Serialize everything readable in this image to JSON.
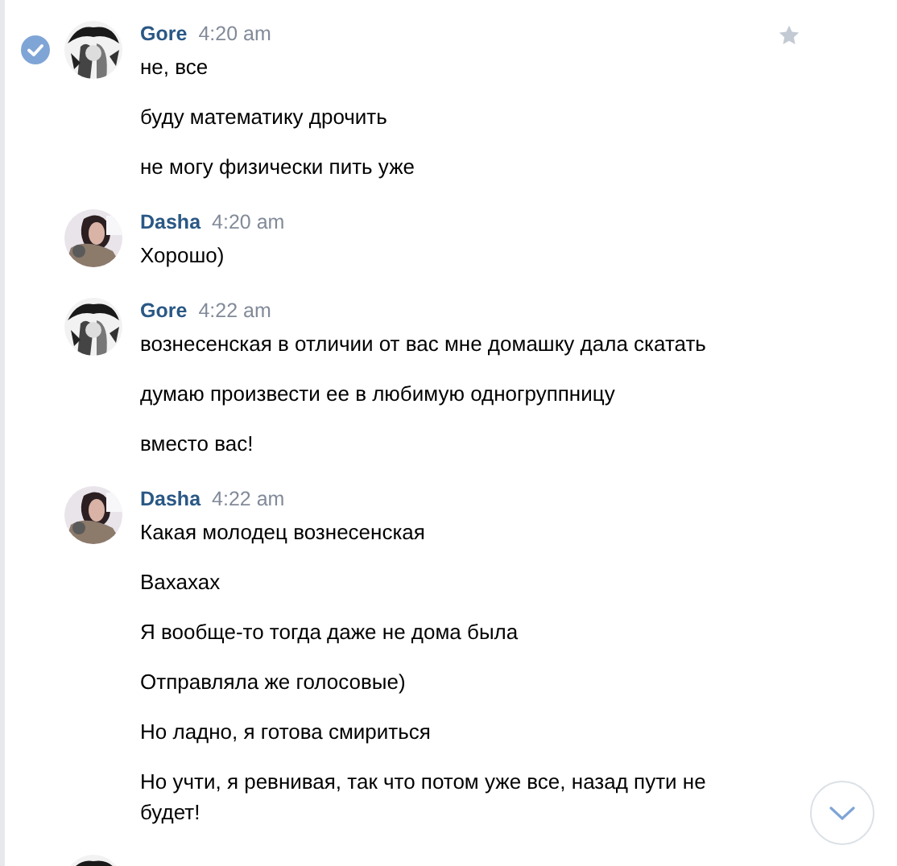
{
  "messages": [
    {
      "author": "Gore",
      "avatar": {
        "kind": "picture"
      },
      "time": "4:20 am",
      "selected": true,
      "texts": [
        "не, все",
        "буду математику дрочить",
        "не могу физически пить уже"
      ]
    },
    {
      "author": "Dasha",
      "avatar": {
        "kind": "picture"
      },
      "time": "4:20 am",
      "selected": false,
      "texts": [
        "Хорошо)"
      ]
    },
    {
      "author": "Gore",
      "avatar": {
        "kind": "picture"
      },
      "time": "4:22 am",
      "selected": false,
      "texts": [
        "вознесенская в отличии от вас мне домашку дала скатать",
        "думаю произвести ее в любимую одногруппницу",
        "вместо вас!"
      ]
    },
    {
      "author": "Dasha",
      "avatar": {
        "kind": "picture"
      },
      "time": "4:22 am",
      "selected": false,
      "texts": [
        "Какая молодец вознесенская",
        "Вахахах",
        "Я вообще-то тогда даже не дома была",
        "Отправляла же голосовые)",
        "Но ладно, я готова смириться",
        "Но учти, я ревнивая, так что потом уже все, назад пути не будет!"
      ]
    }
  ],
  "next_message": {
    "avatar": {
      "kind": "picture"
    }
  }
}
